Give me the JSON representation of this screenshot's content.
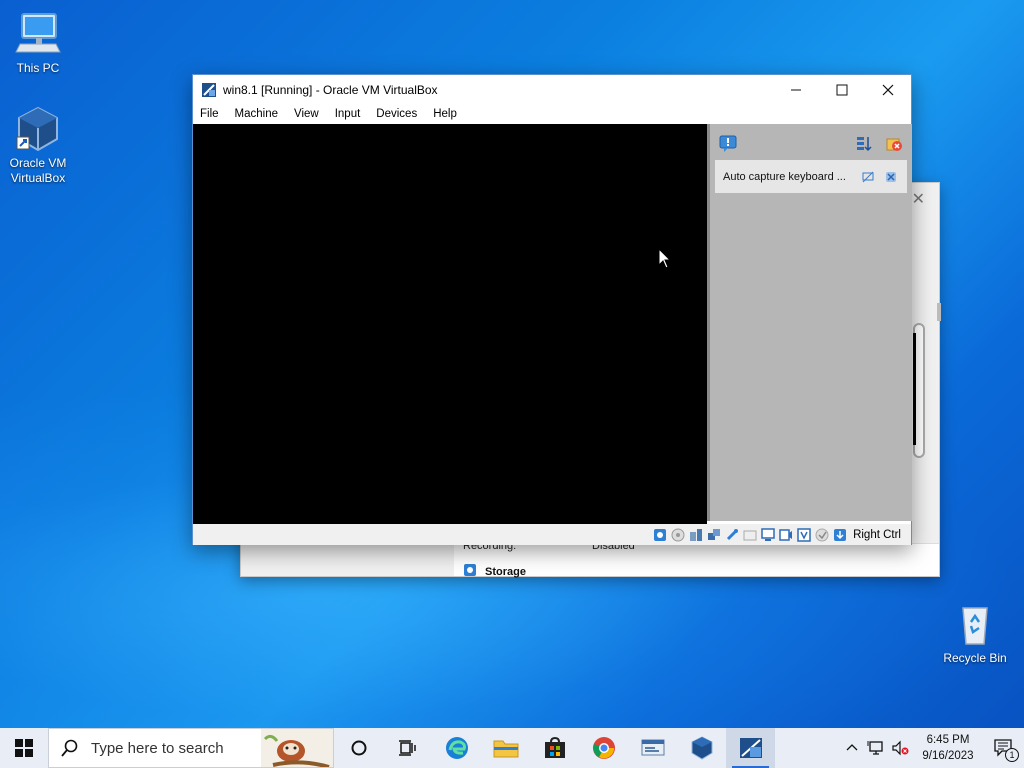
{
  "desktop": {
    "icons": [
      {
        "label": "This PC",
        "icon": "computer-icon"
      },
      {
        "label": "Oracle VM VirtualBox",
        "icon": "virtualbox-icon"
      },
      {
        "label": "Recycle Bin",
        "icon": "recycle-bin-icon"
      }
    ]
  },
  "vm_window": {
    "title": "win8.1 [Running] - Oracle VM VirtualBox",
    "menu": [
      "File",
      "Machine",
      "View",
      "Input",
      "Devices",
      "Help"
    ],
    "notification": {
      "text": "Auto capture keyboard ...",
      "icons": [
        "notification-center-icon",
        "sort-icon",
        "clear-all-icon",
        "dont-show-again-icon",
        "dismiss-icon"
      ]
    },
    "status_bar": {
      "icons": [
        "hard-disk-icon",
        "optical-drive-icon",
        "audio-icon",
        "network-icon",
        "usb-icon",
        "shared-folders-icon",
        "display-icon",
        "recording-icon",
        "cpu-icon",
        "mouse-integration-icon",
        "keyboard-capture-icon"
      ],
      "host_key": "Right Ctrl"
    }
  },
  "bg_window": {
    "row_label": "Recording:",
    "row_value": "Disabled",
    "section": "Storage"
  },
  "taskbar": {
    "search_placeholder": "Type here to search",
    "apps": [
      "cortana-icon",
      "task-view-icon",
      "edge-icon",
      "file-explorer-icon",
      "microsoft-store-icon",
      "chrome-icon",
      "network-window-icon",
      "virtualbox-icon",
      "win81-vm-icon"
    ],
    "time": "6:45 PM",
    "date": "9/16/2023",
    "notification_count": "1"
  },
  "colors": {
    "accent": "#2a6bd1",
    "vm_screen": "#000000",
    "notice_pane": "#b6b6b6"
  }
}
